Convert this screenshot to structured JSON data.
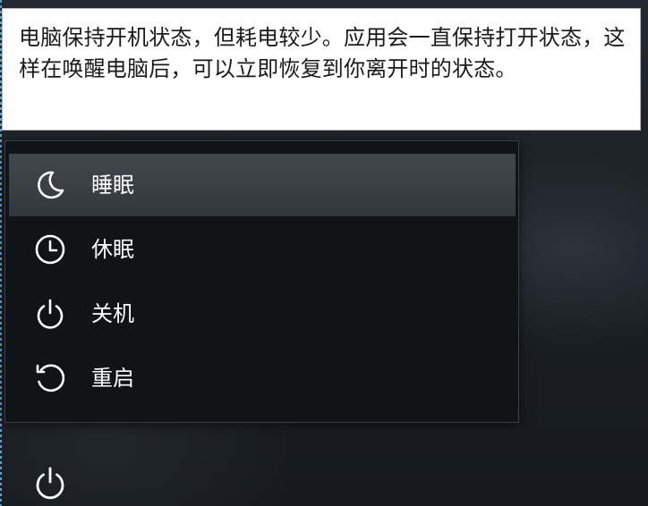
{
  "tooltip": {
    "text": "电脑保持开机状态，但耗电较少。应用会一直保持打开状态，这样在唤醒电脑后，可以立即恢复到你离开时的状态。"
  },
  "power_menu": {
    "items": [
      {
        "label": "睡眠",
        "icon": "moon-icon",
        "selected": true
      },
      {
        "label": "休眠",
        "icon": "clock-icon",
        "selected": false
      },
      {
        "label": "关机",
        "icon": "power-icon",
        "selected": false
      },
      {
        "label": "重启",
        "icon": "restart-icon",
        "selected": false
      }
    ]
  },
  "taskbar": {
    "power_button_icon": "power-icon"
  },
  "colors": {
    "tooltip_bg": "#ffffff",
    "menu_bg": "#111417",
    "selected_bg": "#3a4147",
    "text": "#ffffff",
    "focus_border": "#4aa3df"
  }
}
